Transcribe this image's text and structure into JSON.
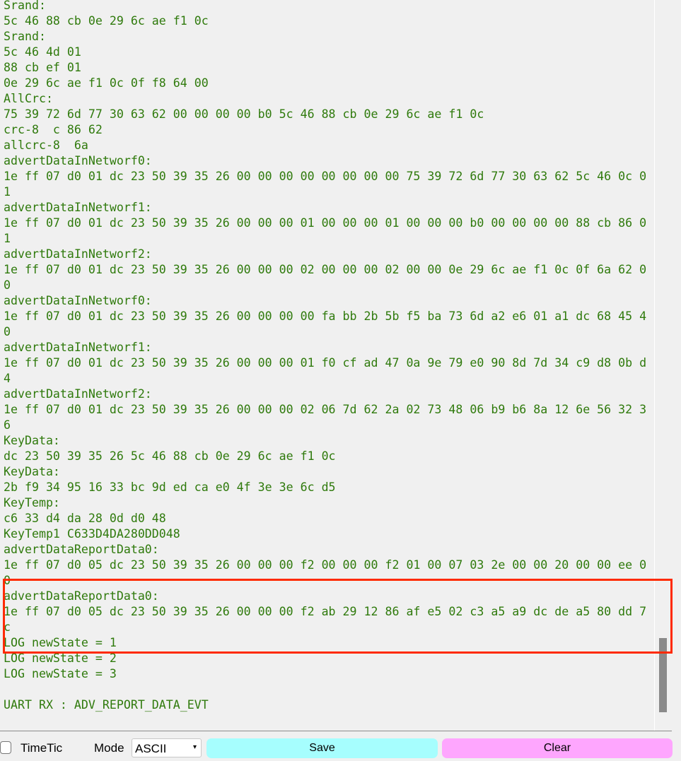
{
  "log": {
    "lines": [
      "Srand:",
      "5c 46 88 cb 0e 29 6c ae f1 0c",
      "Srand:",
      "5c 46 4d 01",
      "88 cb ef 01",
      "0e 29 6c ae f1 0c 0f f8 64 00",
      "AllCrc:",
      "75 39 72 6d 77 30 63 62 00 00 00 00 b0 5c 46 88 cb 0e 29 6c ae f1 0c",
      "crc-8  c 86 62",
      "allcrc-8  6a",
      "advertDataInNetworf0:",
      "1e ff 07 d0 01 dc 23 50 39 35 26 00 00 00 00 00 00 00 00 75 39 72 6d 77 30 63 62 5c 46 0c 0",
      "1",
      "advertDataInNetworf1:",
      "1e ff 07 d0 01 dc 23 50 39 35 26 00 00 00 01 00 00 00 01 00 00 00 b0 00 00 00 00 88 cb 86 0",
      "1",
      "advertDataInNetworf2:",
      "1e ff 07 d0 01 dc 23 50 39 35 26 00 00 00 02 00 00 00 02 00 00 0e 29 6c ae f1 0c 0f 6a 62 0",
      "0",
      "advertDataInNetworf0:",
      "1e ff 07 d0 01 dc 23 50 39 35 26 00 00 00 00 fa bb 2b 5b f5 ba 73 6d a2 e6 01 a1 dc 68 45 4",
      "0",
      "advertDataInNetworf1:",
      "1e ff 07 d0 01 dc 23 50 39 35 26 00 00 00 01 f0 cf ad 47 0a 9e 79 e0 90 8d 7d 34 c9 d8 0b d",
      "4",
      "advertDataInNetworf2:",
      "1e ff 07 d0 01 dc 23 50 39 35 26 00 00 00 02 06 7d 62 2a 02 73 48 06 b9 b6 8a 12 6e 56 32 3",
      "6",
      "KeyData:",
      "dc 23 50 39 35 26 5c 46 88 cb 0e 29 6c ae f1 0c",
      "KeyData:",
      "2b f9 34 95 16 33 bc 9d ed ca e0 4f 3e 3e 6c d5",
      "KeyTemp:",
      "c6 33 d4 da 28 0d d0 48",
      "KeyTemp1 C633D4DA280DD048",
      "advertDataReportData0:",
      "1e ff 07 d0 05 dc 23 50 39 35 26 00 00 00 f2 00 00 00 f2 01 00 07 03 2e 00 00 20 00 00 ee 0",
      "0",
      "advertDataReportData0:",
      "1e ff 07 d0 05 dc 23 50 39 35 26 00 00 00 f2 ab 29 12 86 af e5 02 c3 a5 a9 dc de a5 80 dd 7",
      "c",
      "LOG newState = 1",
      "LOG newState = 2",
      "LOG newState = 3",
      "",
      "UART RX : ADV_REPORT_DATA_EVT"
    ],
    "text_color": "#2f7a0c",
    "highlight_color": "#ff2a00"
  },
  "controls": {
    "timetic_label": "TimeTic",
    "timetic_checked": false,
    "mode_label": "Mode",
    "mode_value": "ASCII",
    "mode_arrow": "▾",
    "save_label": "Save",
    "save_color": "#a6fefe",
    "clear_label": "Clear",
    "clear_color": "#fea6fe"
  }
}
